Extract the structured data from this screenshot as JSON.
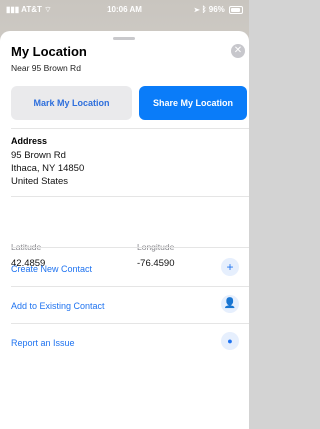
{
  "status_bar": {
    "carrier": "AT&T",
    "time": "10:06 AM",
    "battery": "96%"
  },
  "sheet": {
    "title": "My Location",
    "subtitle": "Near 95 Brown Rd",
    "buttons": {
      "mark": "Mark My Location",
      "share": "Share My Location"
    },
    "address": {
      "label": "Address",
      "lines": [
        "95 Brown Rd",
        "Ithaca, NY  14850",
        "United States"
      ]
    },
    "coordinates": {
      "latitude_label": "Latitude",
      "latitude": "42.4859",
      "longitude_label": "Longitude",
      "longitude": "-76.4590"
    },
    "actions": [
      {
        "label": "Create New Contact",
        "icon": "plus-icon"
      },
      {
        "label": "Add to Existing Contact",
        "icon": "add-person-icon"
      },
      {
        "label": "Report an Issue",
        "icon": "speech-bubble-icon"
      }
    ]
  },
  "colors": {
    "accent": "#0a7cf9",
    "link": "#1f73f0"
  }
}
